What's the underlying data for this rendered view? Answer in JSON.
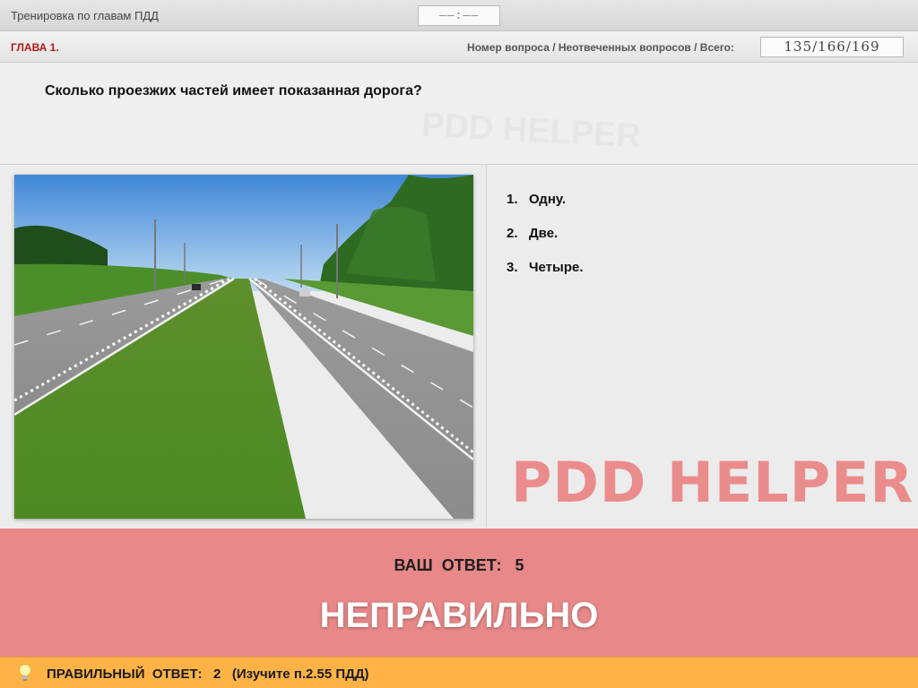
{
  "window": {
    "title": "Тренировка по главам ПДД",
    "timer": "——:——"
  },
  "header": {
    "chapter": "ГЛАВА 1.",
    "counter_label": "Номер вопроса / Неотвеченных вопросов / Всего:",
    "counter_value": "135/166/169"
  },
  "question": {
    "text": "Сколько проезжих частей имеет показанная дорога?"
  },
  "answers": [
    {
      "number": "1.",
      "text": "Одну."
    },
    {
      "number": "2.",
      "text": "Две."
    },
    {
      "number": "3.",
      "text": "Четыре."
    }
  ],
  "watermark": "PDD HELPER",
  "result": {
    "your_answer": "ВАШ  ОТВЕТ:   5",
    "verdict": "НЕПРАВИЛЬНО"
  },
  "footer": {
    "correct_answer": "ПРАВИЛЬНЫЙ  ОТВЕТ:   2   (Изучите п.2.55 ПДД)"
  },
  "icons": {
    "hint": "lightbulb-icon"
  },
  "colors": {
    "chapter_red": "#b01818",
    "result_background": "#e88888",
    "footer_background": "#ffb347",
    "watermark": "#ea8c8c"
  }
}
